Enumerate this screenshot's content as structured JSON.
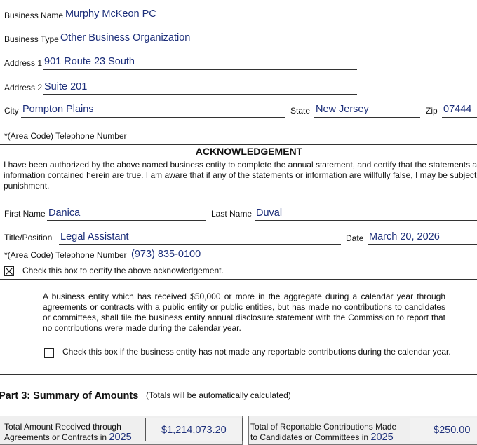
{
  "business": {
    "name_label": "Business Name",
    "name_value": "Murphy McKeon PC",
    "type_label": "Business Type",
    "type_value": "Other Business Organization",
    "addr1_label": "Address 1",
    "addr1_value": "901 Route 23 South",
    "addr2_label": "Address 2",
    "addr2_value": "Suite 201",
    "city_label": "City",
    "city_value": "Pompton Plains",
    "state_label": "State",
    "state_value": "New Jersey",
    "zip_label": "Zip",
    "zip_value": "07444",
    "phone_label": "*(Area Code) Telephone Number",
    "phone_value": ""
  },
  "ack": {
    "heading": "ACKNOWLEDGEMENT",
    "text_line1": "I have been authorized by the above named business entity to complete the annual statement, and certify that the statements an",
    "text_line2": "information contained herein are true. I am aware that if any of the statements or information are willfully false, I may be subject t",
    "text_line3": "punishment.",
    "first_name_label": "First Name",
    "first_name_value": "Danica",
    "last_name_label": "Last Name",
    "last_name_value": "Duval",
    "title_label": "Title/Position",
    "title_value": "Legal Assistant",
    "date_label": "Date",
    "date_value": "March 20, 2026",
    "phone_label": "*(Area Code) Telephone Number",
    "phone_value": "(973) 835-0100",
    "certify_checked": true,
    "certify_label": "Check this box to certify the above acknowledgement."
  },
  "no_contrib": {
    "text": "A business entity which has received $50,000 or more in the aggregate during a calendar year through agreements or contracts with a public entity or public entities, but has made no contributions to candidates or committees, shall file the business entity annual disclosure statement with the Commission to report that no contributions were made during the calendar year.",
    "checkbox_checked": false,
    "checkbox_label": "Check this box if the business entity has not made any reportable contributions during the calendar year."
  },
  "part3": {
    "title": "Part 3: Summary of Amounts",
    "note": "(Totals will be automatically calculated)",
    "received_label_line1": "Total Amount Received through",
    "received_label_line2": "Agreements or Contracts in",
    "received_year": "2025",
    "received_value": "$1,214,073.20",
    "contrib_label_line1": "Total of  Reportable  Contributions  Made",
    "contrib_label_line2": "to Candidates or Committees in",
    "contrib_year": "2025",
    "contrib_value": "$250.00"
  }
}
